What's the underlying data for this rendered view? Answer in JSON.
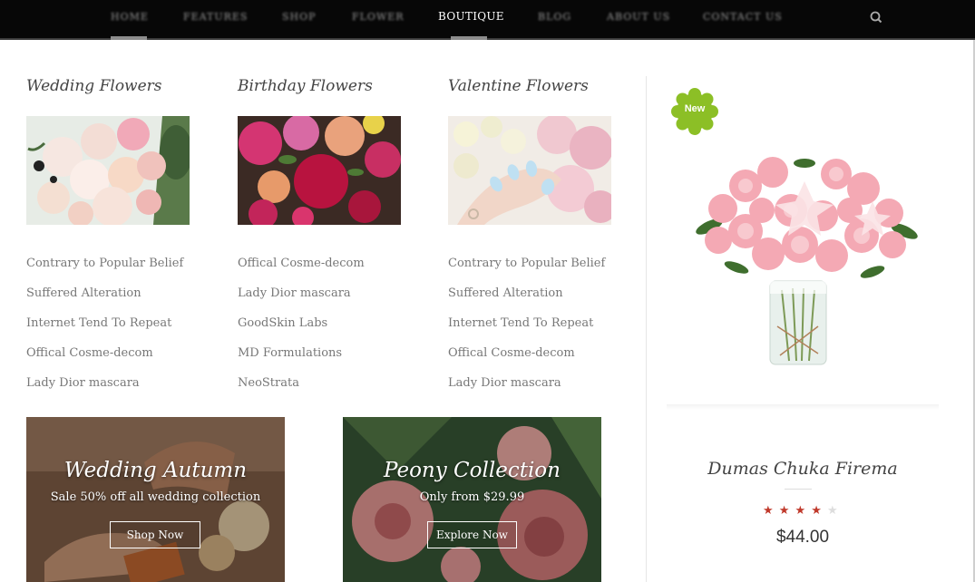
{
  "nav": {
    "items": [
      {
        "label": "HOME",
        "active": false
      },
      {
        "label": "FEATURES",
        "active": false
      },
      {
        "label": "SHOP",
        "active": false
      },
      {
        "label": "FLOWER",
        "active": false
      },
      {
        "label": "BOUTIQUE",
        "active": true
      },
      {
        "label": "BLOG",
        "active": false
      },
      {
        "label": "ABOUT US",
        "active": false
      },
      {
        "label": "CONTACT US",
        "active": false
      }
    ],
    "search_icon": "search-icon"
  },
  "columns": [
    {
      "title": "Wedding Flowers",
      "links": [
        "Contrary to Popular Belief",
        "Suffered Alteration",
        "Internet Tend To Repeat",
        "Offical Cosme-decom",
        "Lady Dior mascara"
      ]
    },
    {
      "title": "Birthday Flowers",
      "links": [
        "Offical Cosme-decom",
        "Lady Dior mascara",
        "GoodSkin Labs",
        "MD Formulations",
        "NeoStrata"
      ]
    },
    {
      "title": "Valentine Flowers",
      "links": [
        "Contrary to Popular Belief",
        "Suffered Alteration",
        "Internet Tend To Repeat",
        "Offical Cosme-decom",
        "Lady Dior mascara"
      ]
    }
  ],
  "banners": [
    {
      "title": "Wedding Autumn",
      "subtitle": "Sale 50% off all wedding collection",
      "button": "Shop Now"
    },
    {
      "title": "Peony Collection",
      "subtitle": "Only from $29.99",
      "button": "Explore Now"
    }
  ],
  "product": {
    "badge": "New",
    "name": "Dumas Chuka Firema",
    "rating": 4,
    "rating_max": 5,
    "price": "$44.00"
  },
  "colors": {
    "nav_bg": "#070707",
    "badge_green": "#8cbf26",
    "star_filled": "#c0392b",
    "star_empty": "#dddddd"
  }
}
